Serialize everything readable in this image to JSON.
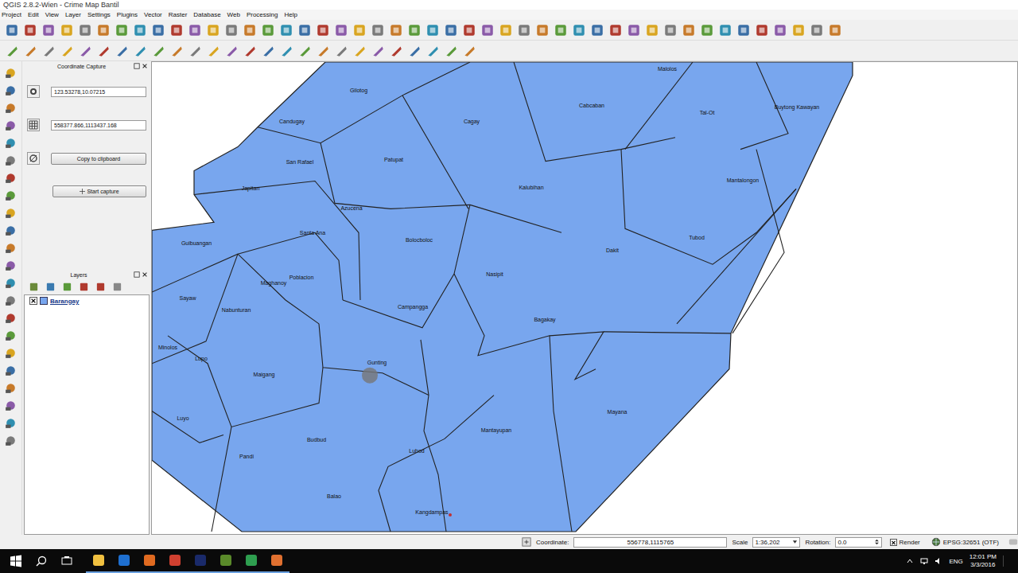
{
  "window": {
    "title": "QGIS 2.8.2-Wien - Crime Map Bantil"
  },
  "menu": [
    "Project",
    "Edit",
    "View",
    "Layer",
    "Settings",
    "Plugins",
    "Vector",
    "Raster",
    "Database",
    "Web",
    "Processing",
    "Help"
  ],
  "coordinate_capture": {
    "title": "Coordinate Capture",
    "geographic": "123.53278,10.07215",
    "projected": "558377.866,1113437.168",
    "copy_button": "Copy to clipboard",
    "start_button": "Start capture"
  },
  "layers": {
    "title": "Layers",
    "items": [
      {
        "name": "Barangay",
        "checked": true
      }
    ]
  },
  "map": {
    "labels": [
      "Malolos",
      "Gilotog",
      "Cabcaban",
      "Tal-Ot",
      "Buytong Kawayan",
      "Candugay",
      "Cagay",
      "San Rafael",
      "Patupat",
      "Japitan",
      "Azucena",
      "Kalubihan",
      "Mantalongon",
      "Santa Ana",
      "Bolocboloc",
      "Tubod",
      "Guibuangan",
      "Dakit",
      "Nasipit",
      "Maghanoy",
      "Poblacion",
      "Sayaw",
      "Nabunturan",
      "Campangga",
      "Bagakay",
      "Minolos",
      "Lupo",
      "Gunting",
      "Maigang",
      "Mayana",
      "Luyo",
      "Mantayupan",
      "Budbud",
      "Pandi",
      "Luhod",
      "Balao",
      "Kangdampas"
    ]
  },
  "status_bar": {
    "coordinate_label": "Coordinate:",
    "coordinate": "556778,1115765",
    "scale_label": "Scale",
    "scale": "1:36,202",
    "rotation_label": "Rotation:",
    "rotation": "0.0",
    "render_label": "Render",
    "render_checked": true,
    "crs": "EPSG:32651 (OTF)"
  },
  "taskbar": {
    "language": "ENG",
    "time": "12:01 PM",
    "date": "3/3/2016"
  }
}
